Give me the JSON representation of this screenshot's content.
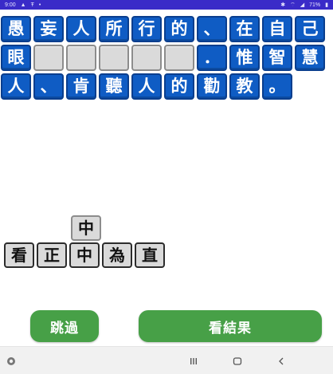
{
  "status_bar": {
    "time": "9:00",
    "icons_left": [
      "notification-icon",
      "app-icon",
      "dot-icon"
    ],
    "icons_right": [
      "bluetooth-icon",
      "wifi-icon",
      "signal-icon"
    ],
    "battery": "71%"
  },
  "puzzle": {
    "row1": [
      "愚",
      "妄",
      "人",
      "所",
      "行",
      "的",
      "、",
      "在",
      "自",
      "己"
    ],
    "row2": [
      "眼",
      "",
      "",
      "",
      "",
      "",
      "．",
      "惟",
      "智",
      "慧"
    ],
    "row3": [
      "人",
      "、",
      "肯",
      "聽",
      "人",
      "的",
      "勸",
      "教",
      "。"
    ]
  },
  "selected_char": "中",
  "candidates": [
    "看",
    "正",
    "中",
    "為",
    "直"
  ],
  "buttons": {
    "skip": "跳過",
    "result": "看結果"
  },
  "colors": {
    "tile_blue": "#0f5cc4",
    "tile_gray": "#dadada",
    "button_green": "#47a047",
    "status_bar": "#3a2bc8"
  }
}
